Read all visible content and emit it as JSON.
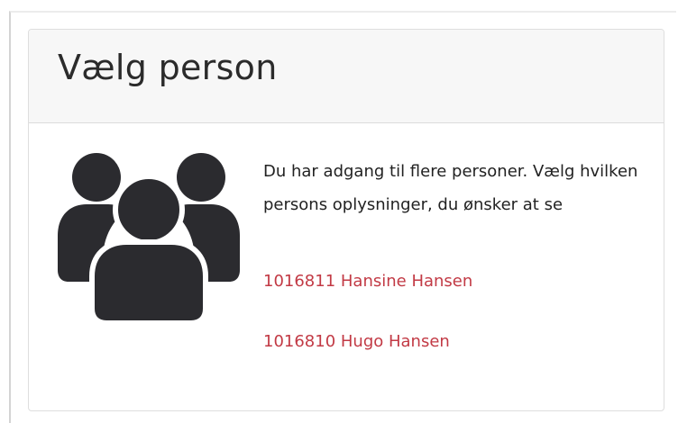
{
  "card": {
    "title": "Vælg person",
    "message": "Du har adgang til flere personer. Vælg hvilken persons oplysninger, du ønsker at se",
    "icon": "people-group-icon",
    "persons": [
      {
        "label": "1016811 Hansine Hansen"
      },
      {
        "label": "1016810 Hugo Hansen"
      }
    ]
  },
  "colors": {
    "link": "#c23a45",
    "icon": "#2b2b2f",
    "header_bg": "#f7f7f7"
  }
}
